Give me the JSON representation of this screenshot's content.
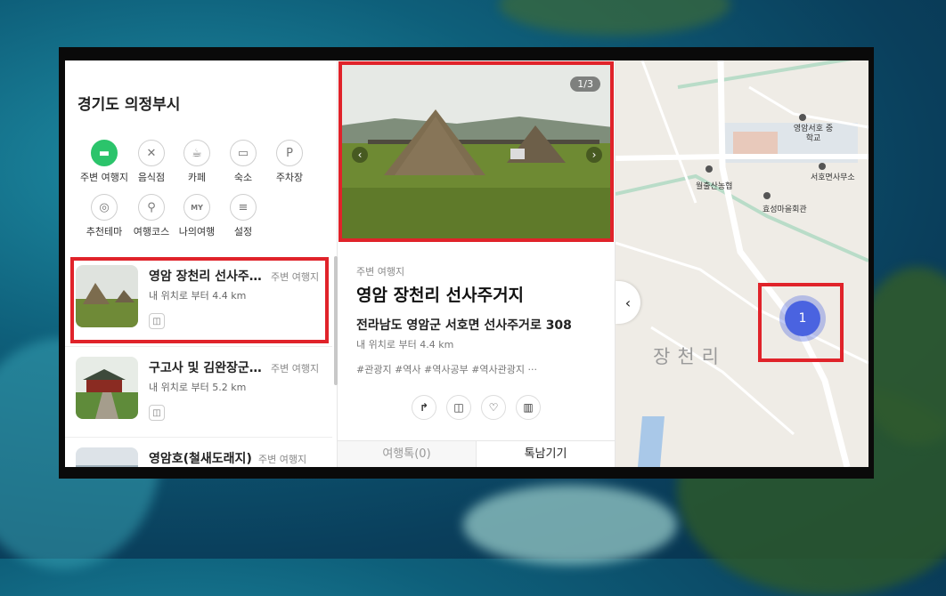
{
  "sidebar": {
    "city": "경기도 의정부시",
    "categories": [
      {
        "label": "주변 여행지",
        "icon": "sofa-icon"
      },
      {
        "label": "음식점",
        "icon": "fork-knife-icon"
      },
      {
        "label": "카페",
        "icon": "coffee-cup-icon"
      },
      {
        "label": "숙소",
        "icon": "bed-icon"
      },
      {
        "label": "주차장",
        "icon": "parking-icon"
      },
      {
        "label": "추천테마",
        "icon": "theme-icon"
      },
      {
        "label": "여행코스",
        "icon": "route-pin-icon"
      },
      {
        "label": "나의여행",
        "icon": "my-badge-icon"
      },
      {
        "label": "설정",
        "icon": "sliders-icon"
      }
    ],
    "items": [
      {
        "title": "영암 장천리 선사주거지",
        "category": "주변 여행지",
        "distance": "내 위치로 부터 4.4 km"
      },
      {
        "title": "구고사 및 김완장군 유적",
        "category": "주변 여행지",
        "distance": "내 위치로 부터 5.2 km"
      },
      {
        "title": "영암호(철새도래지)",
        "category": "주변 여행지",
        "distance": ""
      }
    ]
  },
  "detail": {
    "pager": "1/3",
    "category": "주변 여행지",
    "title": "영암 장천리 선사주거지",
    "address": "전라남도 영암군 서호면 선사주거로 308",
    "distance": "내 위치로 부터 4.4 km",
    "tags": "#관광지  #역사  #역사공부  #역사관광지  ···",
    "tabs": [
      "여행톡(0)",
      "톡남기기"
    ]
  },
  "map": {
    "labels": [
      "영암서호 중학교",
      "월출산농협",
      "서호면사무소",
      "효성마을회관"
    ],
    "area_name": "장천리",
    "cluster_count": "1"
  },
  "colors": {
    "accent_green": "#2bc46b",
    "highlight_red": "#e0232a",
    "cluster_blue": "#4a63e0"
  }
}
